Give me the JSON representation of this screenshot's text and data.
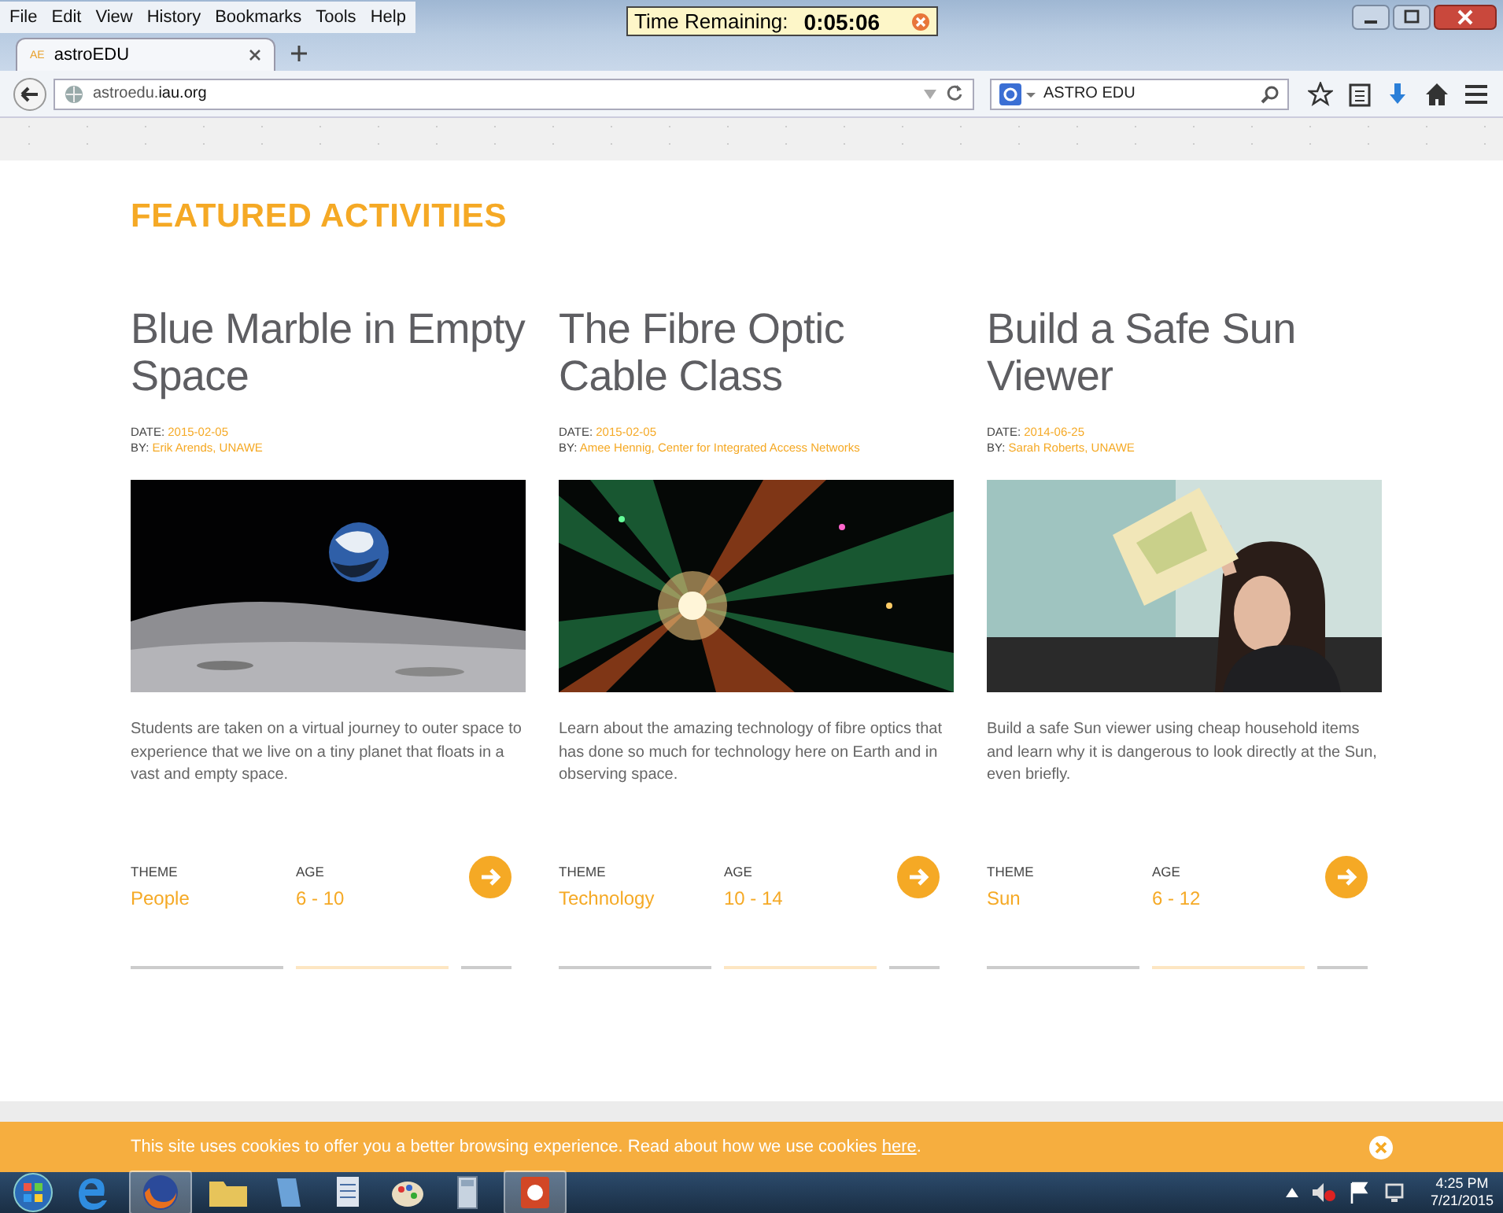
{
  "browser": {
    "menu": [
      "File",
      "Edit",
      "View",
      "History",
      "Bookmarks",
      "Tools",
      "Help"
    ],
    "timer": {
      "label": "Time Remaining:",
      "value": "0:05:06"
    },
    "tab": {
      "icon_text": "AE",
      "title": "astroEDU"
    },
    "url": {
      "host": "astroedu.",
      "domain": "iau.org"
    },
    "search": {
      "value": "ASTRO EDU"
    }
  },
  "page": {
    "heading": "FEATURED ACTIVITIES",
    "cards": [
      {
        "title": "Blue Marble in Empty Space",
        "date_label": "DATE:",
        "date": "2015-02-05",
        "by_label": "BY:",
        "by": "Erik Arends, UNAWE",
        "description": "Students are taken on a virtual journey to outer space to experience that we live on a tiny planet that floats in a vast and empty space.",
        "theme_label": "THEME",
        "theme": "People",
        "age_label": "AGE",
        "age": "6 - 10"
      },
      {
        "title": "The Fibre Optic Cable Class",
        "date_label": "DATE:",
        "date": "2015-02-05",
        "by_label": "BY:",
        "by": "Amee Hennig, Center for Integrated Access Networks",
        "description": "Learn about the amazing technology of fibre optics that has done so much for technology here on Earth and in observing space.",
        "theme_label": "THEME",
        "theme": "Technology",
        "age_label": "AGE",
        "age": "10 - 14"
      },
      {
        "title": "Build a Safe Sun Viewer",
        "date_label": "DATE:",
        "date": "2014-06-25",
        "by_label": "BY:",
        "by": "Sarah Roberts, UNAWE",
        "description": "Build a safe Sun viewer using cheap household items and learn why it is dangerous to look directly at the Sun, even briefly.",
        "theme_label": "THEME",
        "theme": "Sun",
        "age_label": "AGE",
        "age": "6 - 12"
      }
    ],
    "cookie": {
      "text": "This site uses cookies to offer you a better browsing experience. Read about how we use cookies",
      "link": "here",
      "end": "."
    }
  },
  "taskbar": {
    "time": "4:25 PM",
    "date": "7/21/2015"
  }
}
